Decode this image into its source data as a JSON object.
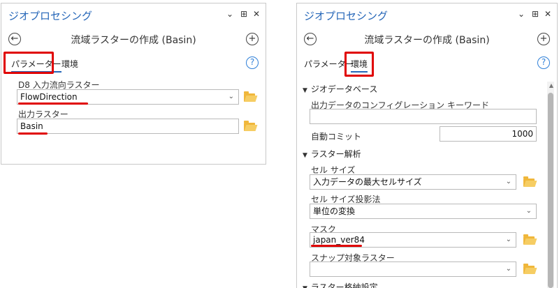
{
  "left": {
    "title": "ジオプロセシング",
    "window_controls": {
      "menu": "⌄",
      "pin": "⊞",
      "close": "✕"
    },
    "tool_title": "流域ラスターの作成 (Basin)",
    "back_icon": "←",
    "add_icon": "+",
    "tabs": [
      {
        "label": "パラメーター",
        "active": true
      },
      {
        "label": "環境",
        "active": false
      }
    ],
    "help_icon": "?",
    "fields": {
      "flow_label": "D8 入力流向ラスター",
      "flow_value": "FlowDirection",
      "out_label": "出力ラスター",
      "out_value": "Basin"
    }
  },
  "right": {
    "title": "ジオプロセシング",
    "window_controls": {
      "menu": "⌄",
      "pin": "⊞",
      "close": "✕"
    },
    "tool_title": "流域ラスターの作成 (Basin)",
    "back_icon": "←",
    "add_icon": "+",
    "tabs": [
      {
        "label": "パラメーター",
        "active": false
      },
      {
        "label": "環境",
        "active": true
      }
    ],
    "help_icon": "?",
    "geodatabase": {
      "header": "ジオデータベース",
      "config_label": "出力データのコンフィグレーション キーワード",
      "config_value": "",
      "autocommit_label": "自動コミット",
      "autocommit_value": "1000"
    },
    "raster_analysis": {
      "header": "ラスター解析",
      "cellsize_label": "セル サイズ",
      "cellsize_value": "入力データの最大セルサイズ",
      "projection_label": "セル サイズ投影法",
      "projection_value": "単位の変換",
      "mask_label": "マスク",
      "mask_value": "japan_ver84",
      "snap_label": "スナップ対象ラスター",
      "snap_value": ""
    },
    "raster_storage_header": "ラスター格納設定"
  },
  "colors": {
    "accent": "#2566b8",
    "highlight": "#e00000",
    "folder": "#f0b73b"
  }
}
